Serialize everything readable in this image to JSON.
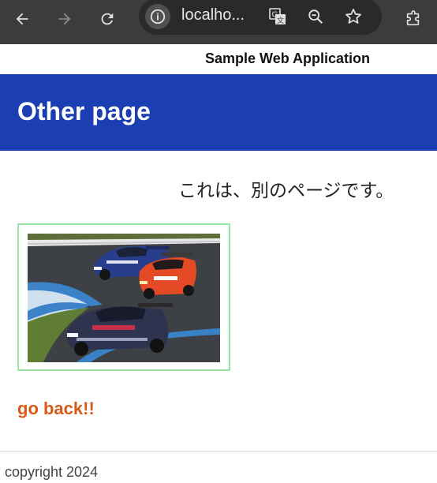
{
  "browser": {
    "url": "localho...",
    "icons": [
      "back-arrow-icon",
      "forward-arrow-icon",
      "reload-icon",
      "site-info-icon",
      "translate-icon",
      "zoom-icon",
      "bookmark-star-icon",
      "extensions-icon"
    ]
  },
  "page": {
    "app_title": "Sample Web Application",
    "heading": "Other page",
    "message": "これは、別のページです。",
    "image_alt": "racing cars photo",
    "back_link": "go back!!",
    "copyright": "copyright 2024"
  },
  "colors": {
    "banner": "#1c3eb3",
    "link": "#d65a1a",
    "image_border": "#9be6a8"
  }
}
